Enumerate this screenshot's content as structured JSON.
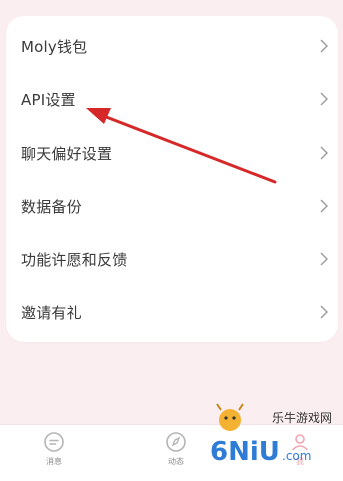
{
  "menu": {
    "items": [
      {
        "label": "Moly钱包"
      },
      {
        "label": "API设置"
      },
      {
        "label": "聊天偏好设置"
      },
      {
        "label": "数据备份"
      },
      {
        "label": "功能许愿和反馈"
      },
      {
        "label": "邀请有礼"
      }
    ]
  },
  "tabbar": {
    "tabs": [
      {
        "label": "消息",
        "icon": "chat-bubble-icon"
      },
      {
        "label": "动态",
        "icon": "discover-icon"
      },
      {
        "label": "我",
        "icon": "profile-icon"
      }
    ]
  },
  "annotation": {
    "icon": "red-arrow-icon",
    "color": "#d62828"
  },
  "watermark": {
    "text": "乐牛游戏网",
    "logo_text": "6NiU.com"
  }
}
